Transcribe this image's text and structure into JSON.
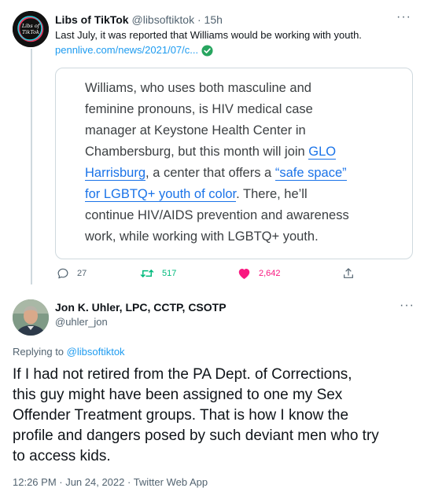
{
  "tweet1": {
    "name": "Libs of TikTok",
    "handle": "@libsoftiktok",
    "separator": "·",
    "time": "15h",
    "more": "···",
    "text": "Last July, it was reported that Williams would be working with youth.",
    "link": "pennlive.com/news/2021/07/c...",
    "avatar_text": "Libs of TikTok",
    "quote": {
      "l1": "Williams, who uses both masculine and",
      "l2": "feminine pronouns, is HIV medical case",
      "l3": "manager at Keystone Health Center in",
      "l4a": "Chambersburg, but this month will join ",
      "l4b": "GLO",
      "l5a": "Harrisburg",
      "l5b": ", a center that offers a ",
      "l5c": "“safe space”",
      "l6a": "for LGBTQ+ youth of color",
      "l6b": ". There, he’ll",
      "l7": "continue HIV/AIDS prevention and awareness",
      "l8": "work, while working with LGBTQ+ youth."
    },
    "actions": {
      "replies": "27",
      "retweets": "517",
      "likes": "2,642"
    }
  },
  "tweet2": {
    "name": "Jon K. Uhler, LPC, CCTP, CSOTP",
    "handle": "@uhler_jon",
    "more": "···",
    "replying_prefix": "Replying to ",
    "replying_handle": "@libsoftiktok",
    "body": {
      "l1": "If I had not retired from the PA Dept. of Corrections,",
      "l2": "this guy might have been assigned to one my Sex",
      "l3": "Offender Treatment groups. That is how I know the",
      "l4": "profile and dangers posed by such deviant men who try",
      "l5": "to access kids."
    },
    "meta": "12:26 PM · Jun 24, 2022 · Twitter Web App"
  },
  "colors": {
    "accent": "#1d9bf0",
    "retweet": "#00ba7c",
    "like": "#f91880",
    "secondary_text": "#536471"
  }
}
